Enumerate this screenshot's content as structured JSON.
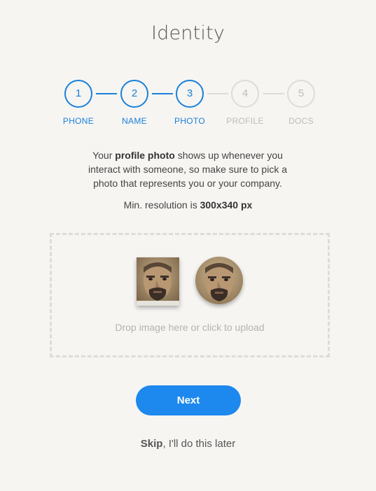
{
  "page": {
    "title": "Identity"
  },
  "stepper": {
    "steps": [
      {
        "number": "1",
        "label": "PHONE",
        "state": "complete"
      },
      {
        "number": "2",
        "label": "NAME",
        "state": "complete"
      },
      {
        "number": "3",
        "label": "PHOTO",
        "state": "current"
      },
      {
        "number": "4",
        "label": "PROFILE",
        "state": "upcoming"
      },
      {
        "number": "5",
        "label": "DOCS",
        "state": "upcoming"
      }
    ]
  },
  "description": {
    "prefix": "Your ",
    "bold": "profile photo",
    "suffix": " shows up whenever you interact with someone, so make sure to pick a photo that represents you or your company."
  },
  "min_resolution": {
    "prefix": "Min. resolution is ",
    "value": "300x340 px"
  },
  "dropzone": {
    "text": "Drop image here or click to upload"
  },
  "next_button": {
    "label": "Next"
  },
  "skip": {
    "bold": "Skip",
    "rest": ", I'll do this later"
  },
  "colors": {
    "accent": "#1d88ed",
    "inactive": "#bdbcb8",
    "background": "#f6f5f2"
  }
}
